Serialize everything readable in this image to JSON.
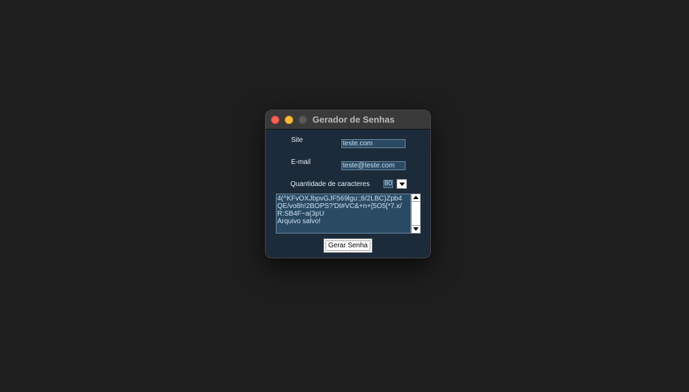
{
  "window": {
    "title": "Gerador de Senhas"
  },
  "form": {
    "site_label": "Site",
    "site_value": "teste.com",
    "email_label": "E-mail",
    "email_value": "teste@teste.com",
    "quantity_label": "Quantidade de caracteres",
    "quantity_value": "80"
  },
  "output": {
    "lines": [
      "4(^KFvOXJbpvGJF569lgu:;8/2LBC)Zpb4",
      "QE/vo8h!2BOPS?'Dt#VC&+n+[5O5[*7.x/",
      "R:SB4F~a(3pU",
      "Arquivo salvo!"
    ]
  },
  "actions": {
    "generate_label": "Gerar Senha"
  },
  "colors": {
    "desktop": "#1e1e1e",
    "window_bg": "#1c2b3a",
    "field_bg": "#2a4a64",
    "close": "#fe5f57",
    "minimize": "#febc2e",
    "zoom_disabled": "#5a5a5a"
  }
}
